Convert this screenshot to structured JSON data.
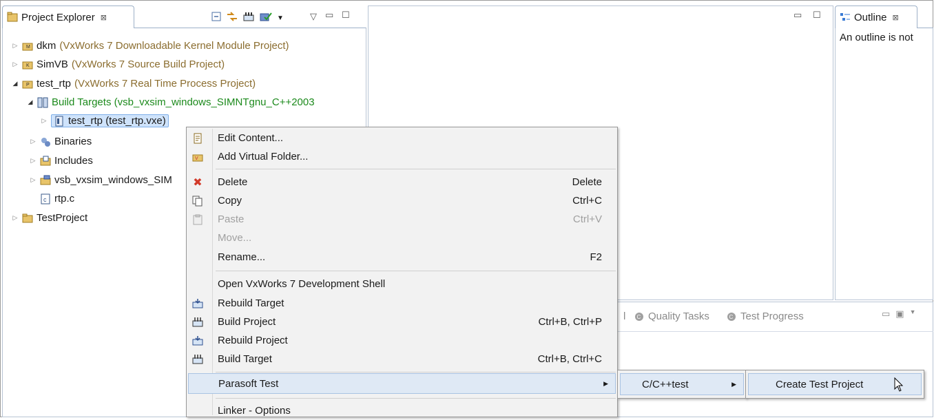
{
  "project_explorer": {
    "title": "Project Explorer",
    "close_glyph": "⊠",
    "toolbar_icons": [
      "collapse-all-icon",
      "link-with-editor-icon",
      "build-icon",
      "check-icon",
      "dropdown-arrow-icon"
    ],
    "tree": [
      {
        "name": "dkm",
        "suffix": "(VxWorks 7 Downloadable Kernel Module Project)",
        "icon": "project-dkm-icon",
        "expanded": false
      },
      {
        "name": "SimVB",
        "suffix": "(VxWorks 7 Source Build Project)",
        "icon": "project-vsb-icon",
        "expanded": false
      },
      {
        "name": "test_rtp",
        "suffix": "(VxWorks 7 Real Time Process Project)",
        "icon": "project-rtp-icon",
        "expanded": true
      },
      {
        "name": "Build Targets (vsb_vxsim_windows_SIMNTgnu_C++2003",
        "icon": "build-targets-icon",
        "expanded": true
      },
      {
        "name": "test_rtp (test_rtp.vxe)",
        "icon": "build-target-icon",
        "expanded": false,
        "selected": true
      },
      {
        "name": "Binaries",
        "icon": "binaries-icon",
        "expanded": false
      },
      {
        "name": "Includes",
        "icon": "includes-icon",
        "expanded": false
      },
      {
        "name": "vsb_vxsim_windows_SIM",
        "icon": "folder-icon",
        "expanded": false
      },
      {
        "name": "rtp.c",
        "icon": "c-file-icon"
      },
      {
        "name": "TestProject",
        "icon": "project-icon",
        "expanded": false
      }
    ]
  },
  "outline": {
    "title": "Outline",
    "close_glyph": "⊠",
    "message": "An outline is not"
  },
  "bottom_tabs": {
    "partial": "l",
    "quality_tasks": "Quality Tasks",
    "test_progress": "Test Progress"
  },
  "context_menu": {
    "items": [
      {
        "label": "Edit Content...",
        "icon": "edit-content-icon"
      },
      {
        "label": "Add Virtual Folder...",
        "icon": "virtual-folder-icon"
      },
      {
        "label": "Delete",
        "shortcut": "Delete",
        "icon": "delete-icon"
      },
      {
        "label": "Copy",
        "shortcut": "Ctrl+C",
        "icon": "copy-icon"
      },
      {
        "label": "Paste",
        "shortcut": "Ctrl+V",
        "icon": "paste-icon",
        "disabled": true
      },
      {
        "label": "Move...",
        "disabled": true
      },
      {
        "label": "Rename...",
        "shortcut": "F2"
      },
      {
        "label": "Open VxWorks 7 Development Shell"
      },
      {
        "label": "Rebuild Target",
        "icon": "rebuild-target-icon"
      },
      {
        "label": "Build Project",
        "shortcut": "Ctrl+B, Ctrl+P",
        "icon": "build-project-icon"
      },
      {
        "label": "Rebuild Project",
        "icon": "rebuild-project-icon"
      },
      {
        "label": "Build Target",
        "shortcut": "Ctrl+B, Ctrl+C",
        "icon": "build-target-menu-icon"
      },
      {
        "label": "Parasoft Test",
        "submenu": true
      },
      {
        "label": "Linker - Options"
      }
    ]
  },
  "submenu_cpptest": {
    "label": "C/C++test"
  },
  "submenu_create": {
    "label": "Create Test Project"
  },
  "colors": {
    "project_suffix": "#8b6d2f",
    "build_targets": "#1c8a1c",
    "selection": "#cfe3fb"
  }
}
